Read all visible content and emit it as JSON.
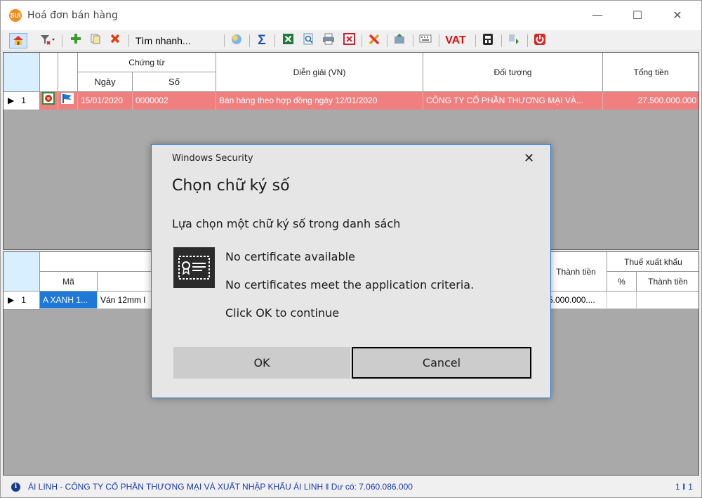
{
  "window": {
    "app_icon_text": "SUI",
    "title": "Hoá đơn bán hàng",
    "min_glyph": "—",
    "max_glyph": "☐",
    "close_glyph": "✕"
  },
  "toolbar": {
    "search_label": "Tìm nhanh...",
    "vat_label": "VAT",
    "icons": [
      "home-icon",
      "filter-icon",
      "add-icon",
      "copy-icon",
      "delete-icon",
      "search-icon",
      "sum-icon",
      "excel-icon",
      "preview-icon",
      "print-icon",
      "close-doc-icon",
      "tools-icon",
      "export-icon",
      "keyboard-icon",
      "calculator-icon",
      "refresh-icon",
      "power-icon"
    ]
  },
  "top_grid": {
    "headers": {
      "chung_tu": "Chứng từ",
      "ngay": "Ngày",
      "so": "Số",
      "dien_giai": "Diễn giải (VN)",
      "doi_tuong": "Đối tượng",
      "tong_tien": "Tổng tiền"
    },
    "row": {
      "index": "1",
      "ngay": "15/01/2020",
      "so": "0000002",
      "dien_giai": "Bán hàng theo hợp đồng ngày 12/01/2020",
      "doi_tuong": "CÔNG TY CỔ PHẦN THƯƠNG MẠI VÀ...",
      "tong_tien": "27.500.000.000"
    },
    "row_color": "#f08080"
  },
  "bottom_grid": {
    "headers": {
      "ma": "Mã",
      "thanh_tien": "Thành tiền",
      "thue_xuat_khau": "Thuế xuất khẩu",
      "phan_tram": "%",
      "thue_thanh_tien": "Thành tiền"
    },
    "row": {
      "index": "1",
      "ma": "A XANH 1...",
      "ten": "Ván 12mm l",
      "thanh_tien": "5.000.000...."
    },
    "cell_highlight": "#1e78d8"
  },
  "status_bar": {
    "text": "ÁI LINH - CÔNG TY CỔ PHẦN THƯƠNG MẠI VÀ XUẤT NHẬP KHẨU ÁI LINH ‖ Dư có: 7.060.086.000",
    "page": "1 ‖ 1",
    "info_glyph": "i"
  },
  "dialog": {
    "caption": "Windows Security",
    "close_glyph": "✕",
    "title": "Chọn chữ ký số",
    "subtitle": "Lựa chọn một chữ ký số trong danh sách",
    "line1": "No certificate available",
    "line2": "No certificates meet the application criteria.",
    "line3": "Click OK to continue",
    "ok_label": "OK",
    "cancel_label": "Cancel",
    "accent": "#1e78d8"
  }
}
